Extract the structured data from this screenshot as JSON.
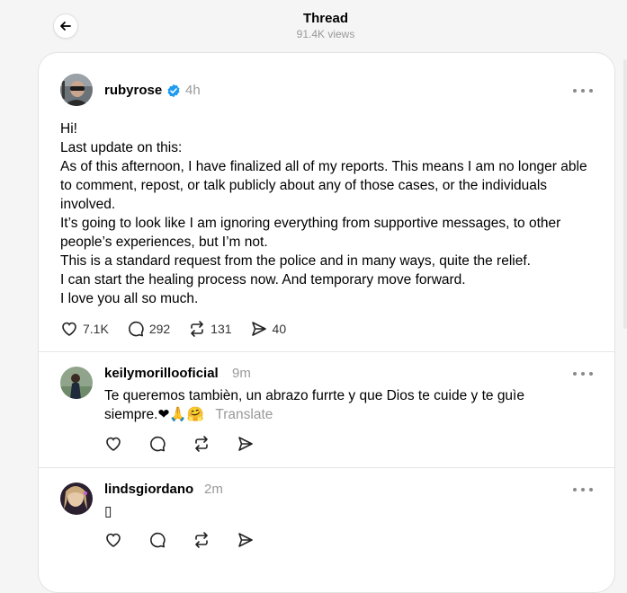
{
  "header": {
    "title": "Thread",
    "views": "91.4K views"
  },
  "main_post": {
    "username": "rubyrose",
    "time": "4h",
    "text": "Hi!\nLast update on this:\nAs of this afternoon, I have finalized all of my reports. This means I am no longer able to comment, repost, or talk publicly about any of those cases, or the individuals involved.\nIt’s going to look like I am ignoring everything from supportive messages, to other people’s experiences, but I’m not.\nThis is a standard request from the police and in many ways, quite the relief.\nI can start the healing process now. And temporary move forward.\nI love you all so much.",
    "likes": "7.1K",
    "replies": "292",
    "reposts": "131",
    "shares": "40"
  },
  "replies": [
    {
      "username": "keilymorillooficial",
      "time": "9m",
      "text_line1": "Te queremos tambièn, un abrazo furrte y que Dios te cuide y te guìe",
      "text_line2": "siempre.",
      "emojis": "❤🙏🤗",
      "translate": "Translate"
    },
    {
      "username": "lindsgiordano",
      "time": "2m",
      "text": "▯"
    }
  ],
  "colors": {
    "verified": "#1d9bf0",
    "muted": "#999999",
    "border": "#e6e6e6"
  }
}
